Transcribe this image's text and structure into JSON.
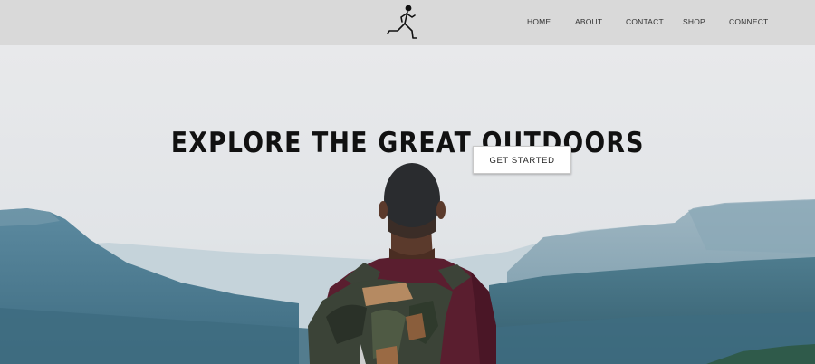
{
  "nav": {
    "items": [
      {
        "label": "HOME"
      },
      {
        "label": "ABOUT"
      },
      {
        "label": "CONTACT"
      },
      {
        "label": "SHOP"
      },
      {
        "label": "CONNECT"
      }
    ]
  },
  "logo": {
    "icon": "runner-icon"
  },
  "hero": {
    "headline": "EXPLORE THE GREAT OUTDOORS",
    "cta_label": "GET STARTED",
    "image": "hiker-with-backpack-overlooking-mountains"
  },
  "colors": {
    "header_bg": "#d9d9d9",
    "sky": "#e6e7e9",
    "mountains": "#4f7f93",
    "shirt": "#5a1e2f"
  }
}
